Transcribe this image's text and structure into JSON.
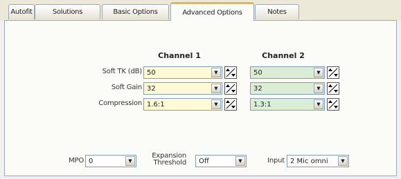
{
  "tabs": [
    "Autofit",
    "Solutions",
    "Basic Options",
    "Advanced Options",
    "Notes"
  ],
  "active_tab": "Advanced Options",
  "channels": {
    "ch1_title": "Channel 1",
    "ch2_title": "Channel 2"
  },
  "rows": [
    {
      "label": "Soft TK  (dB)",
      "ch1": "50",
      "ch2": "50"
    },
    {
      "label": "Soft Gain",
      "ch1": "32",
      "ch2": "32"
    },
    {
      "label": "Compression",
      "ch1": "1.6:1",
      "ch2": "1.3:1"
    }
  ],
  "bottom": {
    "mpo_label": "MPO",
    "mpo_value": "0",
    "expansion_label_1": "Expansion",
    "expansion_label_2": "Threshold",
    "expansion_value": "Off",
    "input_label": "Input",
    "input_value": "2 Mic omni"
  },
  "colors": {
    "channel1_field": "#fffad6",
    "channel2_field": "#dcedd6",
    "active_tab_accent": "#f2b23e"
  },
  "icons": {
    "dropdown": "chevron-down-icon",
    "adjust": "up-down-adjust-icon"
  }
}
